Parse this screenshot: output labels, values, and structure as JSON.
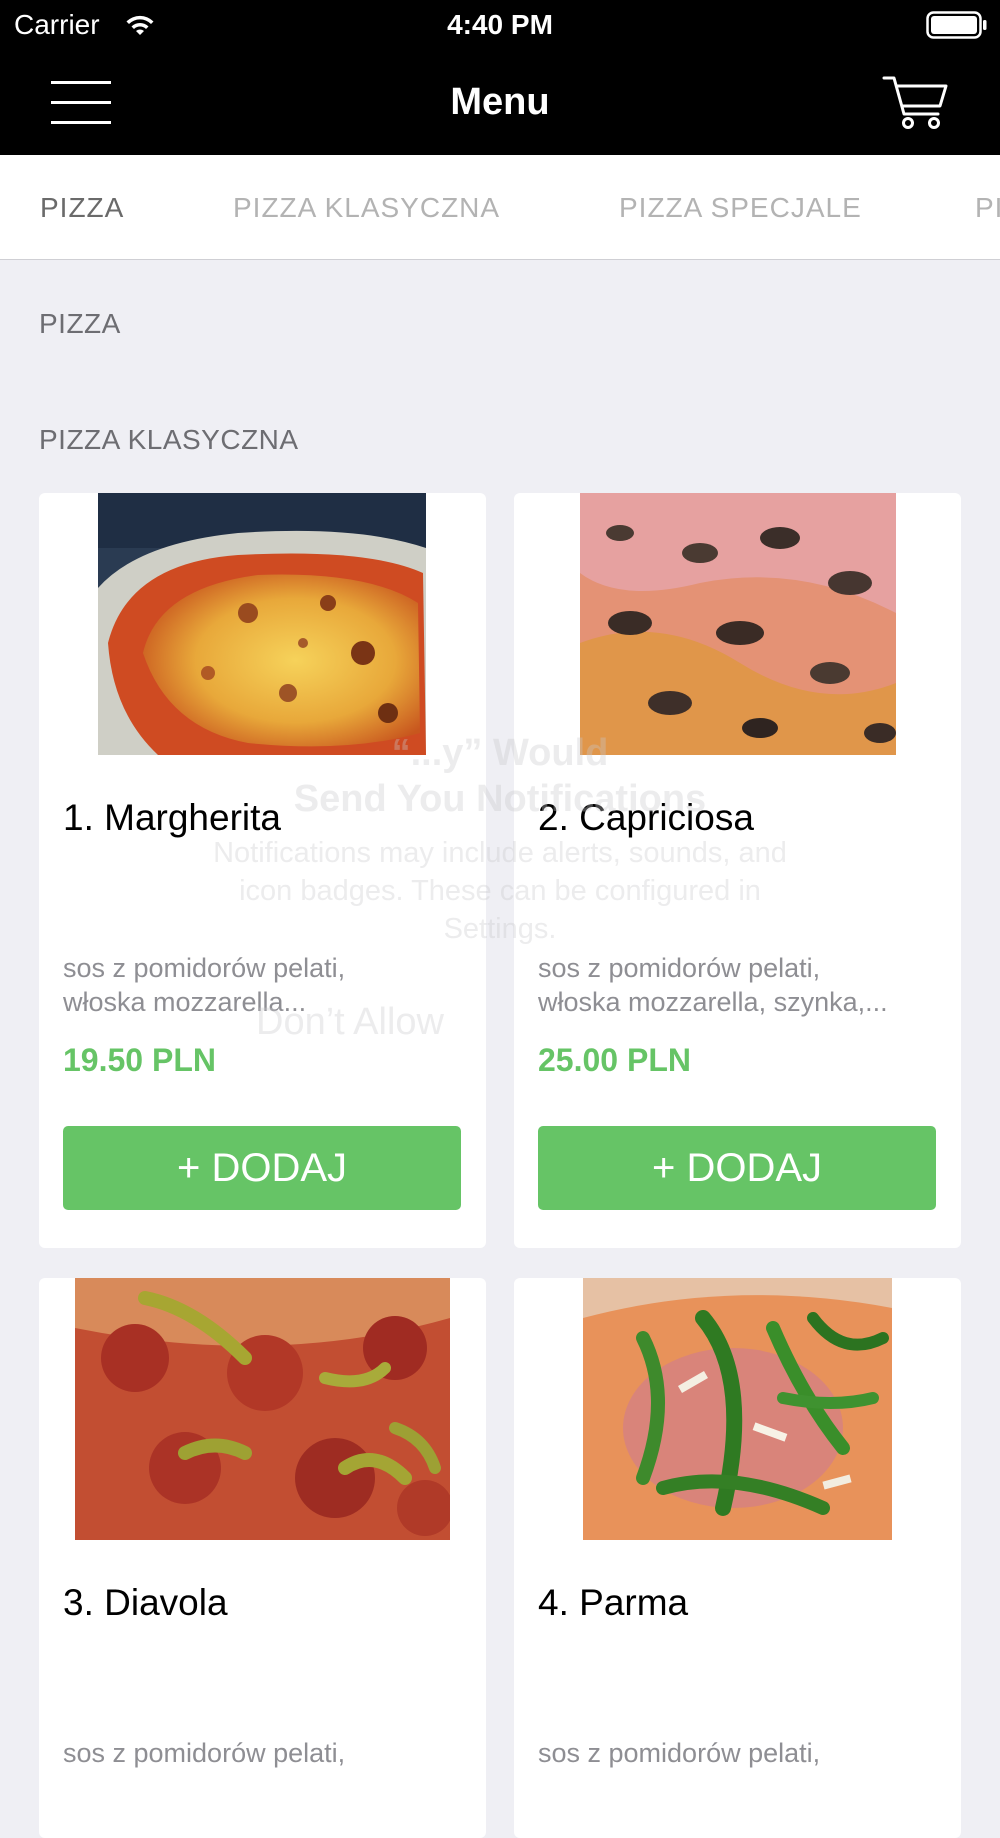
{
  "status_bar": {
    "carrier": "Carrier",
    "time": "4:40 PM",
    "wifi_icon": "wifi-icon",
    "battery_icon": "battery-full-icon"
  },
  "nav": {
    "title": "Menu",
    "menu_icon": "hamburger-menu-icon",
    "cart_icon": "shopping-cart-icon"
  },
  "tabs": [
    {
      "label": "PIZZA",
      "active": true
    },
    {
      "label": "PIZZA KLASYCZNA",
      "active": false
    },
    {
      "label": "PIZZA SPECJALE",
      "active": false
    },
    {
      "label": "PI",
      "active": false
    }
  ],
  "sections": [
    {
      "title": "PIZZA"
    },
    {
      "title": "PIZZA KLASYCZNA"
    }
  ],
  "products": [
    {
      "name": "1. Margherita",
      "description_lines": [
        "sos z pomidorów pelati,",
        "włoska mozzarella..."
      ],
      "price": "19.50 PLN",
      "add_label": "+ DODAJ"
    },
    {
      "name": "2. Capriciosa",
      "description_lines": [
        "sos z pomidorów pelati,",
        "włoska mozzarella, szynka,..."
      ],
      "price": "25.00 PLN",
      "add_label": "+ DODAJ"
    },
    {
      "name": "3. Diavola",
      "description_lines": [
        "sos z pomidorów pelati,"
      ],
      "price": "",
      "add_label": ""
    },
    {
      "name": "4. Parma",
      "description_lines": [
        "sos z pomidorów pelati,"
      ],
      "price": "",
      "add_label": ""
    }
  ],
  "background_alert": {
    "title_line_1": "“...y” Would",
    "title_line_2": "Send You Notifications",
    "message": "Notifications may include alerts, sounds, and icon badges. These can be configured in Settings.",
    "dont_allow_label": "Don’t Allow"
  },
  "colors": {
    "bar_background": "#000000",
    "page_background": "#efeff4",
    "accent_green": "#66c466",
    "active_tab": "#6a6a6a",
    "inactive_tab": "#b3b3b3",
    "description_gray": "#8e8e93"
  }
}
